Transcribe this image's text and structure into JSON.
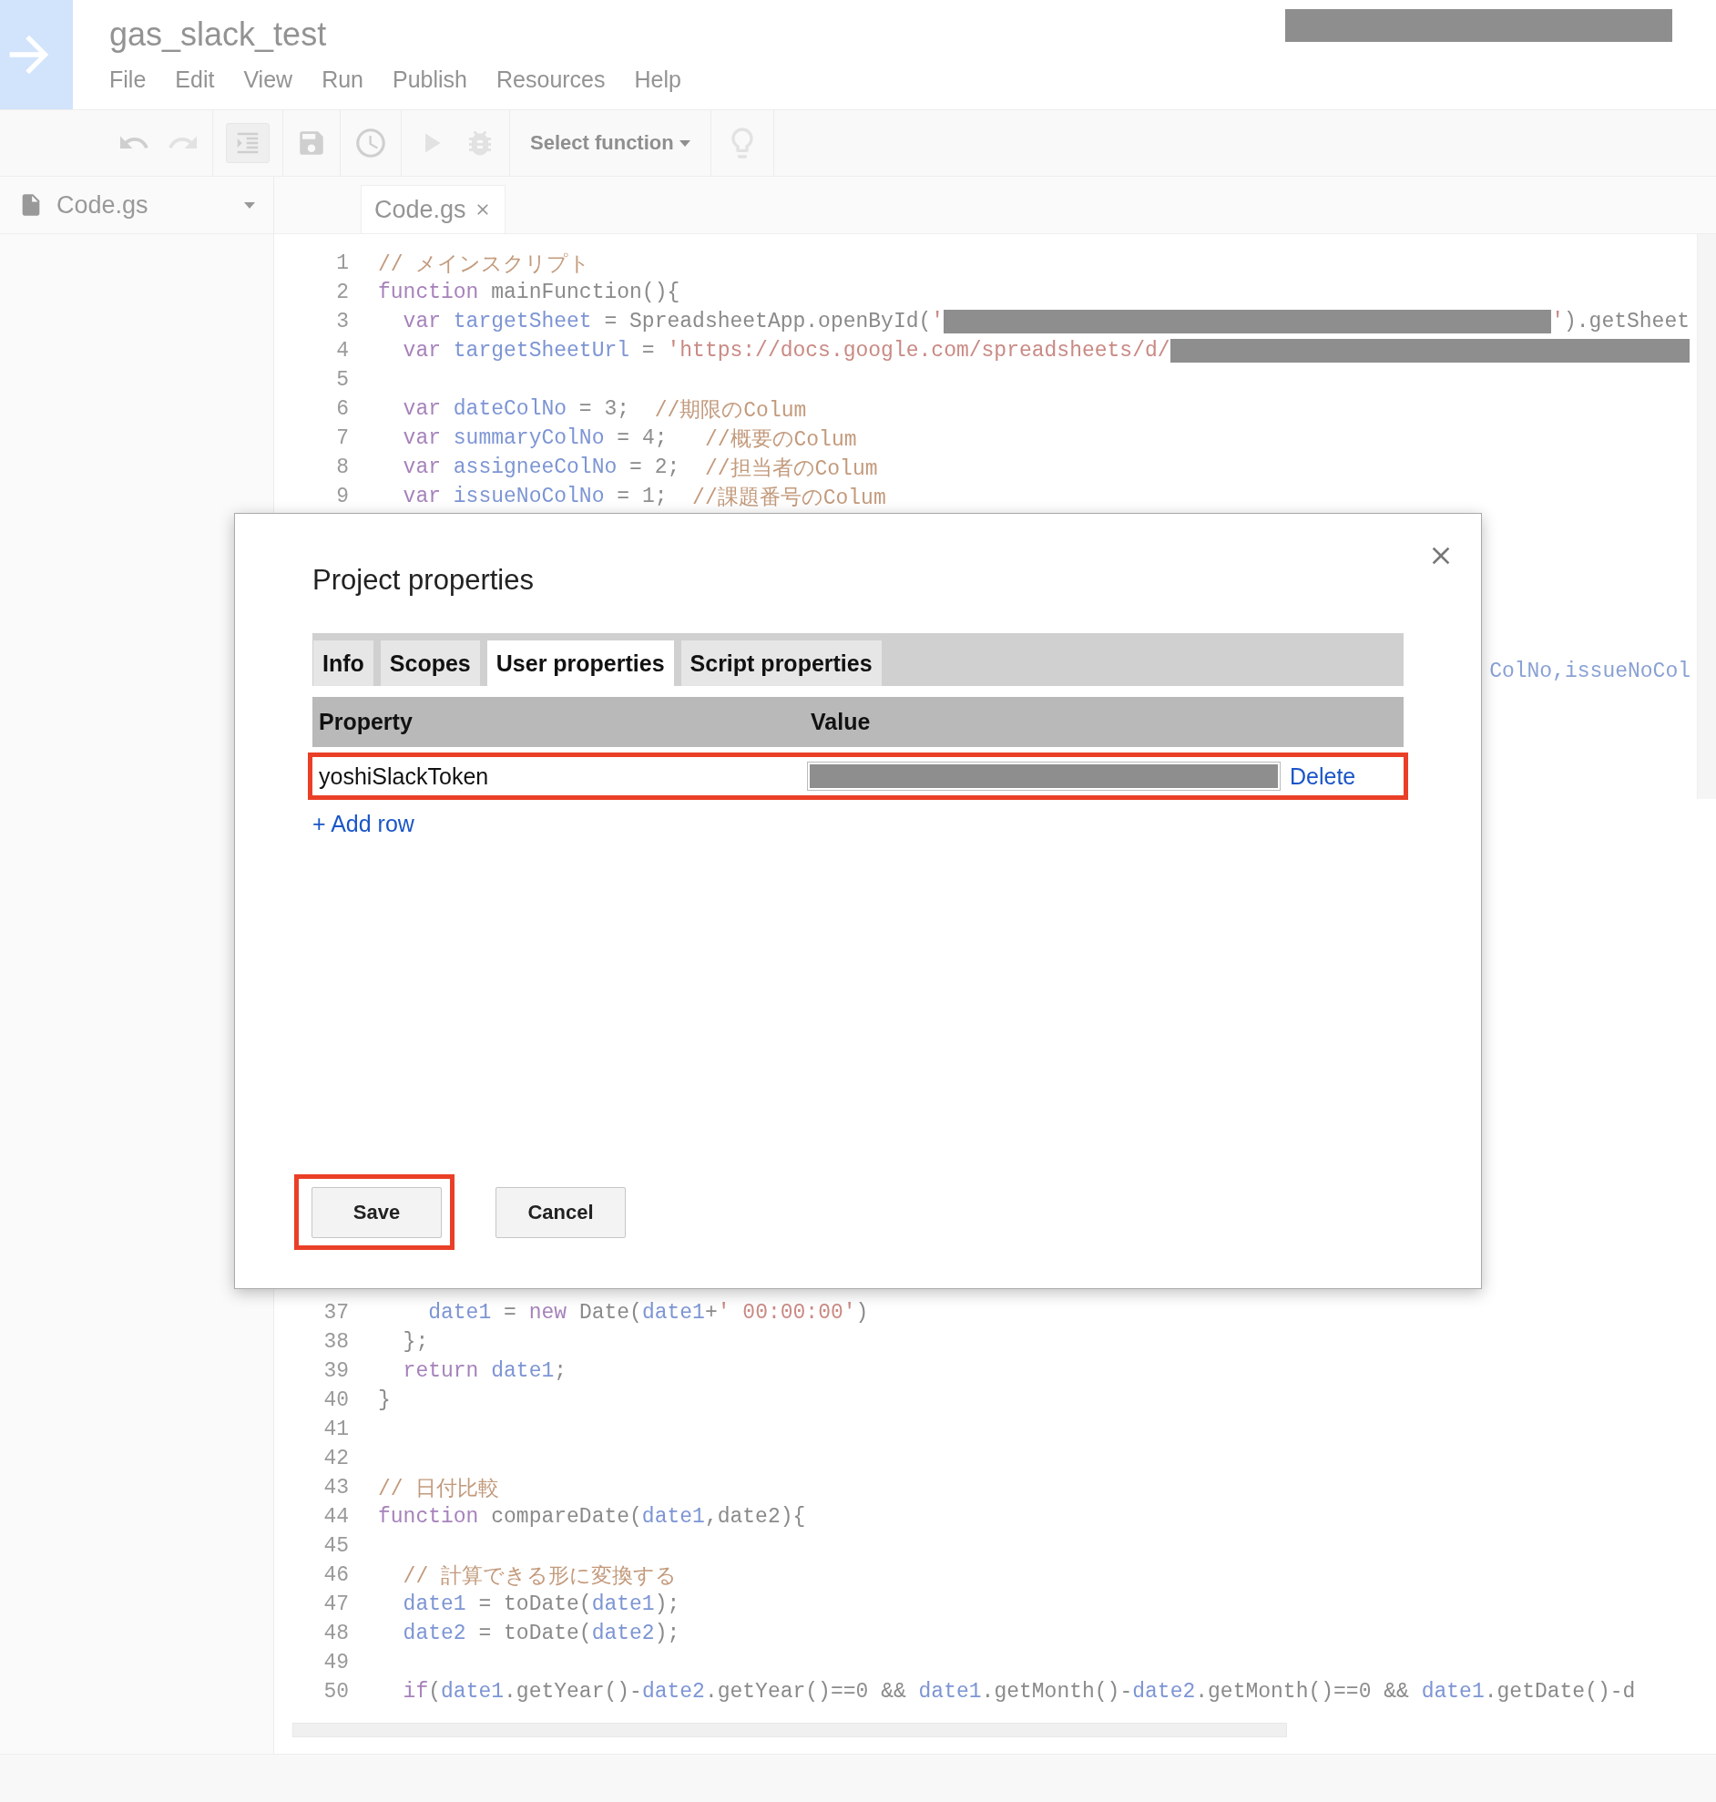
{
  "app": {
    "title": "gas_slack_test",
    "menu": [
      "File",
      "Edit",
      "View",
      "Run",
      "Publish",
      "Resources",
      "Help"
    ]
  },
  "toolbar": {
    "function_select": "Select function"
  },
  "sidebar": {
    "files": [
      "Code.gs"
    ]
  },
  "editor_tabs": [
    "Code.gs"
  ],
  "code": {
    "top": [
      {
        "number": "1",
        "tokens": [
          {
            "kind": "comment",
            "text": "// メインスクリプト"
          }
        ]
      },
      {
        "number": "2",
        "tokens": [
          {
            "kind": "keyword",
            "text": "function"
          },
          {
            "kind": "plain",
            "text": " mainFunction(){"
          }
        ]
      },
      {
        "number": "3",
        "tokens": [
          {
            "kind": "keyword",
            "text": "  var"
          },
          {
            "kind": "variable",
            "text": " targetSheet"
          },
          {
            "kind": "plain",
            "text": " = SpreadsheetApp.openById("
          },
          {
            "kind": "string",
            "text": "'"
          },
          {
            "kind": "redacted"
          },
          {
            "kind": "string",
            "text": "'"
          },
          {
            "kind": "plain",
            "text": ").getSheet"
          }
        ]
      },
      {
        "number": "4",
        "tokens": [
          {
            "kind": "keyword",
            "text": "  var"
          },
          {
            "kind": "variable",
            "text": " targetSheetUrl"
          },
          {
            "kind": "plain",
            "text": " = "
          },
          {
            "kind": "string",
            "text": "'https://docs.google.com/spreadsheets/d/"
          },
          {
            "kind": "redacted"
          }
        ]
      },
      {
        "number": "5"
      },
      {
        "number": "6",
        "tokens": [
          {
            "kind": "keyword",
            "text": "  var"
          },
          {
            "kind": "variable",
            "text": " dateColNo"
          },
          {
            "kind": "plain",
            "text": " = "
          },
          {
            "kind": "number",
            "text": "3"
          },
          {
            "kind": "plain",
            "text": ";  "
          },
          {
            "kind": "comment",
            "text": "//期限のColum"
          }
        ]
      },
      {
        "number": "7",
        "tokens": [
          {
            "kind": "keyword",
            "text": "  var"
          },
          {
            "kind": "variable",
            "text": " summaryColNo"
          },
          {
            "kind": "plain",
            "text": " = "
          },
          {
            "kind": "number",
            "text": "4"
          },
          {
            "kind": "plain",
            "text": ";   "
          },
          {
            "kind": "comment",
            "text": "//概要のColum"
          }
        ]
      },
      {
        "number": "8",
        "tokens": [
          {
            "kind": "keyword",
            "text": "  var"
          },
          {
            "kind": "variable",
            "text": " assigneeColNo"
          },
          {
            "kind": "plain",
            "text": " = "
          },
          {
            "kind": "number",
            "text": "2"
          },
          {
            "kind": "plain",
            "text": ";  "
          },
          {
            "kind": "comment",
            "text": "//担当者のColum"
          }
        ]
      },
      {
        "number": "9",
        "tokens": [
          {
            "kind": "keyword",
            "text": "  var"
          },
          {
            "kind": "variable",
            "text": " issueNoColNo"
          },
          {
            "kind": "plain",
            "text": " = "
          },
          {
            "kind": "number",
            "text": "1"
          },
          {
            "kind": "plain",
            "text": ";  "
          },
          {
            "kind": "comment",
            "text": "//課題番号のColum"
          }
        ]
      }
    ],
    "fragment": "ColNo,issueNoCol",
    "bottom": [
      {
        "number": "37",
        "tokens": [
          {
            "kind": "variable",
            "text": "    date1"
          },
          {
            "kind": "plain",
            "text": " = "
          },
          {
            "kind": "keyword",
            "text": "new"
          },
          {
            "kind": "plain",
            "text": " Date("
          },
          {
            "kind": "variable",
            "text": "date1"
          },
          {
            "kind": "plain",
            "text": "+"
          },
          {
            "kind": "string",
            "text": "' 00:00:00'"
          },
          {
            "kind": "plain",
            "text": ")"
          }
        ]
      },
      {
        "number": "38",
        "tokens": [
          {
            "kind": "plain",
            "text": "  };"
          }
        ]
      },
      {
        "number": "39",
        "tokens": [
          {
            "kind": "keyword",
            "text": "  return"
          },
          {
            "kind": "variable",
            "text": " date1"
          },
          {
            "kind": "plain",
            "text": ";"
          }
        ]
      },
      {
        "number": "40",
        "tokens": [
          {
            "kind": "plain",
            "text": "}"
          }
        ]
      },
      {
        "number": "41"
      },
      {
        "number": "42"
      },
      {
        "number": "43",
        "tokens": [
          {
            "kind": "comment",
            "text": "// 日付比較"
          }
        ]
      },
      {
        "number": "44",
        "tokens": [
          {
            "kind": "keyword",
            "text": "function"
          },
          {
            "kind": "plain",
            "text": " compareDate("
          },
          {
            "kind": "variable",
            "text": "date1"
          },
          {
            "kind": "plain",
            "text": ",date2"
          },
          {
            "kind": "plain",
            "text": "){"
          }
        ]
      },
      {
        "number": "45"
      },
      {
        "number": "46",
        "tokens": [
          {
            "kind": "comment",
            "text": "  // 計算できる形に変換する"
          }
        ]
      },
      {
        "number": "47",
        "tokens": [
          {
            "kind": "variable",
            "text": "  date1"
          },
          {
            "kind": "plain",
            "text": " = toDate("
          },
          {
            "kind": "variable",
            "text": "date1"
          },
          {
            "kind": "plain",
            "text": ");"
          }
        ]
      },
      {
        "number": "48",
        "tokens": [
          {
            "kind": "variable",
            "text": "  date2"
          },
          {
            "kind": "plain",
            "text": " = toDate("
          },
          {
            "kind": "variable",
            "text": "date2"
          },
          {
            "kind": "plain",
            "text": ");"
          }
        ]
      },
      {
        "number": "49"
      },
      {
        "number": "50",
        "tokens": [
          {
            "kind": "keyword",
            "text": "  if"
          },
          {
            "kind": "plain",
            "text": "("
          },
          {
            "kind": "variable",
            "text": "date1"
          },
          {
            "kind": "plain",
            "text": ".getYear()-"
          },
          {
            "kind": "variable",
            "text": "date2"
          },
          {
            "kind": "plain",
            "text": ".getYear()=="
          },
          {
            "kind": "number",
            "text": "0"
          },
          {
            "kind": "plain",
            "text": " && "
          },
          {
            "kind": "variable",
            "text": "date1"
          },
          {
            "kind": "plain",
            "text": ".getMonth()-"
          },
          {
            "kind": "variable",
            "text": "date2"
          },
          {
            "kind": "plain",
            "text": ".getMonth()=="
          },
          {
            "kind": "number",
            "text": "0"
          },
          {
            "kind": "plain",
            "text": " && "
          },
          {
            "kind": "variable",
            "text": "date1"
          },
          {
            "kind": "plain",
            "text": ".getDate()-d"
          }
        ]
      }
    ]
  },
  "dialog": {
    "title": "Project properties",
    "tabs": [
      {
        "label": "Info",
        "selected": false
      },
      {
        "label": "Scopes",
        "selected": false
      },
      {
        "label": "User properties",
        "selected": true
      },
      {
        "label": "Script properties",
        "selected": false
      }
    ],
    "table": {
      "columns": [
        "Property",
        "Value"
      ],
      "rows": [
        {
          "property": "yoshiSlackToken",
          "action": "Delete",
          "highlighted": true
        }
      ]
    },
    "add_row": "+ Add row",
    "buttons": [
      {
        "label": "Save",
        "highlighted": true
      },
      {
        "label": "Cancel",
        "highlighted": false
      }
    ]
  }
}
